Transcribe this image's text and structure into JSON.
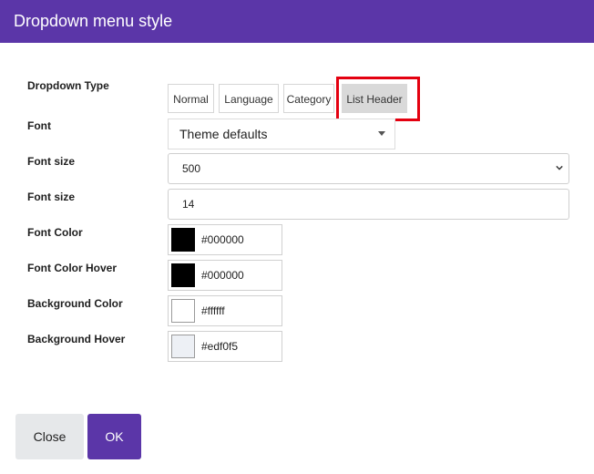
{
  "dialog": {
    "title": "Dropdown menu style"
  },
  "form": {
    "dropdown_type": {
      "label": "Dropdown Type",
      "options": [
        "Normal",
        "Language",
        "Category",
        "List Header"
      ],
      "selected": "List Header"
    },
    "font": {
      "label": "Font",
      "value": "Theme defaults"
    },
    "font_weight": {
      "label": "Font size",
      "value": "500"
    },
    "font_size": {
      "label": "Font size",
      "value": "14"
    },
    "font_color": {
      "label": "Font Color",
      "value": "#000000",
      "swatch": "#000000"
    },
    "font_color_hover": {
      "label": "Font Color Hover",
      "value": "#000000",
      "swatch": "#000000"
    },
    "background_color": {
      "label": "Background Color",
      "value": "#ffffff",
      "swatch": "#ffffff"
    },
    "background_hover": {
      "label": "Background Hover",
      "value": "#edf0f5",
      "swatch": "#edf0f5"
    }
  },
  "footer": {
    "close_label": "Close",
    "ok_label": "OK"
  },
  "colors": {
    "accent": "#5b36a8",
    "highlight_border": "#e40010"
  }
}
